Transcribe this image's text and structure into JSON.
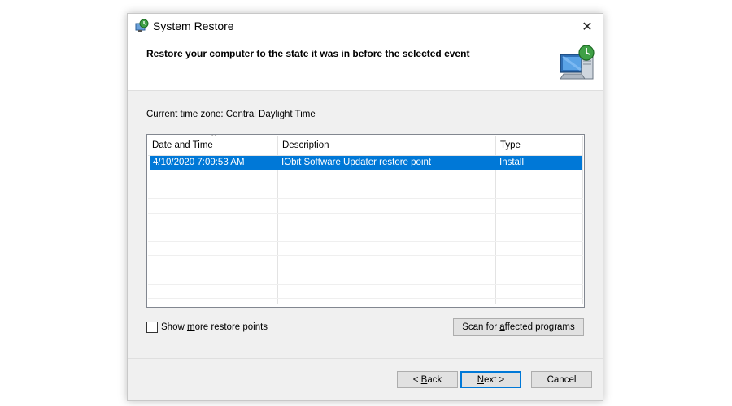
{
  "window": {
    "title": "System Restore",
    "headline": "Restore your computer to the state it was in before the selected event"
  },
  "timezone_label": "Current time zone: Central Daylight Time",
  "table": {
    "columns": [
      "Date and Time",
      "Description",
      "Type"
    ],
    "rows": [
      {
        "date": "4/10/2020 7:09:53 AM",
        "description": "IObit Software Updater restore point",
        "type": "Install",
        "selected": true
      }
    ]
  },
  "checkbox": {
    "label_pre": "Show ",
    "label_accel": "m",
    "label_post": "ore restore points",
    "checked": false
  },
  "buttons": {
    "scan": {
      "pre": "Scan for ",
      "accel": "a",
      "post": "ffected programs"
    },
    "back": {
      "pre": "< ",
      "accel": "B",
      "post": "ack"
    },
    "next": {
      "pre": "",
      "accel": "N",
      "post": "ext >"
    },
    "cancel": "Cancel"
  },
  "colors": {
    "selection": "#0078d7",
    "dialog_bg": "#f0f0f0",
    "header_bg": "#ffffff"
  },
  "icons": {
    "title": "system-restore-icon",
    "hero": "system-restore-computer-icon",
    "close": "close-icon"
  }
}
